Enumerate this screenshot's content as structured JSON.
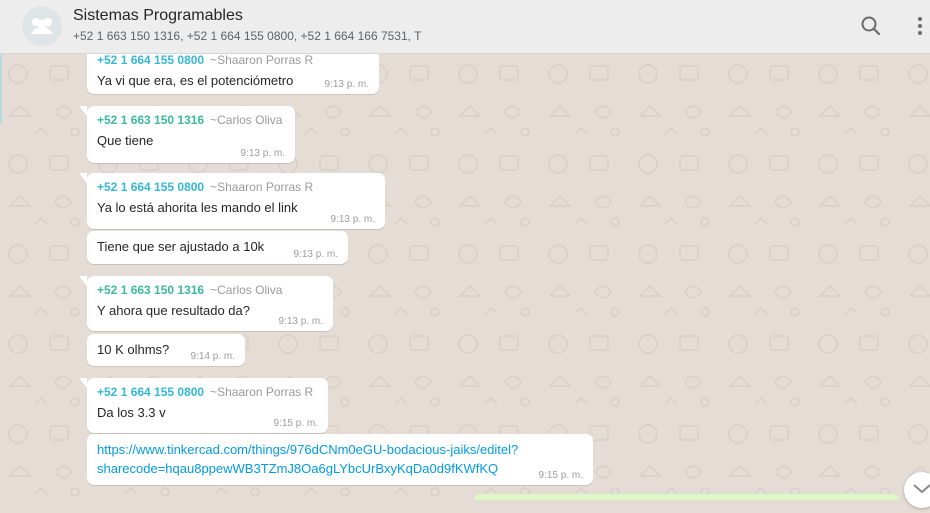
{
  "header": {
    "title": "Sistemas Programables",
    "subtitle": "+52 1 663 150 1316, +52 1 664 155 0800, +52 1 664 166 7531, T",
    "avatar_icon": "group-icon",
    "search_icon": "search-icon",
    "menu_icon": "more-vertical-icon"
  },
  "colors": {
    "sender_sharon": "#35b8d6",
    "sender_carlos": "#3ab99f",
    "link": "#039be5",
    "chat_bg": "#e5ddd5"
  },
  "messages": [
    {
      "sender_number": "+52 1 664 155 0800",
      "sender_alias": "~Shaaron Porras R",
      "text": "Ya vi que era, es el potenciómetro",
      "time": "9:13 p. m."
    },
    {
      "sender_number": "+52 1 663 150 1316",
      "sender_alias": "~Carlos Oliva",
      "text": "Que tiene",
      "time": "9:13 p. m."
    },
    {
      "sender_number": "+52 1 664 155 0800",
      "sender_alias": "~Shaaron Porras R",
      "text": "Ya lo está ahorita les mando el link",
      "time": "9:13 p. m."
    },
    {
      "text": "Tiene que ser ajustado a 10k",
      "time": "9:13 p. m."
    },
    {
      "sender_number": "+52 1 663 150 1316",
      "sender_alias": "~Carlos Oliva",
      "text": "Y ahora que resultado da?",
      "time": "9:13 p. m."
    },
    {
      "text": "10 K olhms?",
      "time": "9:14 p. m."
    },
    {
      "sender_number": "+52 1 664 155 0800",
      "sender_alias": "~Shaaron Porras R",
      "text": "Da los 3.3 v",
      "time": "9:15 p. m."
    },
    {
      "link_line1": "https://www.tinkercad.com/things/976dCNm0eGU-bodacious-jaiks/editel?",
      "link_line2": "sharecode=hqau8ppewWB3TZmJ8Oa6gLYbcUrBxyKqDa0d9fKWfKQ",
      "time": "9:15 p. m."
    }
  ],
  "scroll_down_icon": "chevron-down-icon"
}
